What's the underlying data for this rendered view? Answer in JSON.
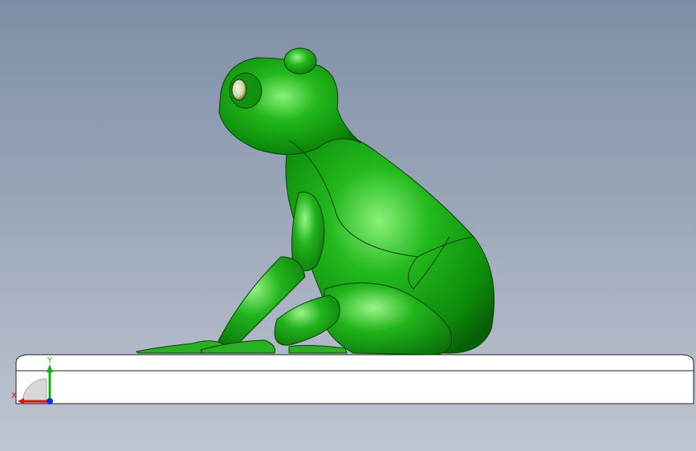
{
  "viewport": {
    "background_top": "#7f8ea6",
    "background_bottom": "#c0c6d1"
  },
  "model": {
    "subject": "frog-figurine",
    "body_color": "#1fa31a",
    "base_color": "#ffffff"
  },
  "triad": {
    "x_label": "X",
    "y_label": "Y",
    "x_color": "#e01010",
    "y_color": "#10b010",
    "z_color": "#1030e0"
  }
}
